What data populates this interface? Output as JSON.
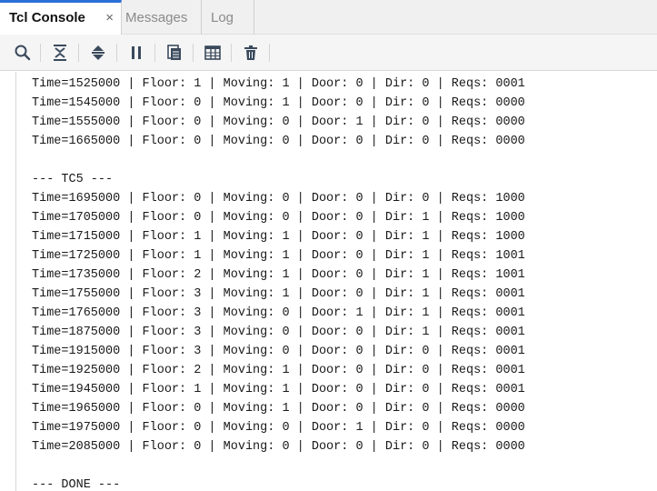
{
  "tabs": [
    {
      "label": "Tcl Console",
      "active": true,
      "close": "×"
    },
    {
      "label": "Messages",
      "active": false
    },
    {
      "label": "Log",
      "active": false
    }
  ],
  "toolbar": {
    "icons": [
      "search-icon",
      "collapse-all-icon",
      "expand-collapse-icon",
      "pause-icon",
      "copy-icon",
      "table-icon",
      "delete-icon"
    ]
  },
  "colors": {
    "accent": "#2b6fd6",
    "toolbar_icon": "#3a4a5c",
    "text": "#1a1a1a"
  },
  "console": {
    "lines": [
      "Time=1525000 | Floor: 1 | Moving: 1 | Door: 0 | Dir: 0 | Reqs: 0001",
      "Time=1545000 | Floor: 0 | Moving: 1 | Door: 0 | Dir: 0 | Reqs: 0000",
      "Time=1555000 | Floor: 0 | Moving: 0 | Door: 1 | Dir: 0 | Reqs: 0000",
      "Time=1665000 | Floor: 0 | Moving: 0 | Door: 0 | Dir: 0 | Reqs: 0000",
      "",
      "--- TC5 ---",
      "Time=1695000 | Floor: 0 | Moving: 0 | Door: 0 | Dir: 0 | Reqs: 1000",
      "Time=1705000 | Floor: 0 | Moving: 0 | Door: 0 | Dir: 1 | Reqs: 1000",
      "Time=1715000 | Floor: 1 | Moving: 1 | Door: 0 | Dir: 1 | Reqs: 1000",
      "Time=1725000 | Floor: 1 | Moving: 1 | Door: 0 | Dir: 1 | Reqs: 1001",
      "Time=1735000 | Floor: 2 | Moving: 1 | Door: 0 | Dir: 1 | Reqs: 1001",
      "Time=1755000 | Floor: 3 | Moving: 1 | Door: 0 | Dir: 1 | Reqs: 0001",
      "Time=1765000 | Floor: 3 | Moving: 0 | Door: 1 | Dir: 1 | Reqs: 0001",
      "Time=1875000 | Floor: 3 | Moving: 0 | Door: 0 | Dir: 1 | Reqs: 0001",
      "Time=1915000 | Floor: 3 | Moving: 0 | Door: 0 | Dir: 0 | Reqs: 0001",
      "Time=1925000 | Floor: 2 | Moving: 1 | Door: 0 | Dir: 0 | Reqs: 0001",
      "Time=1945000 | Floor: 1 | Moving: 1 | Door: 0 | Dir: 0 | Reqs: 0001",
      "Time=1965000 | Floor: 0 | Moving: 1 | Door: 0 | Dir: 0 | Reqs: 0000",
      "Time=1975000 | Floor: 0 | Moving: 0 | Door: 1 | Dir: 0 | Reqs: 0000",
      "Time=2085000 | Floor: 0 | Moving: 0 | Door: 0 | Dir: 0 | Reqs: 0000",
      "",
      "--- DONE ---"
    ]
  }
}
